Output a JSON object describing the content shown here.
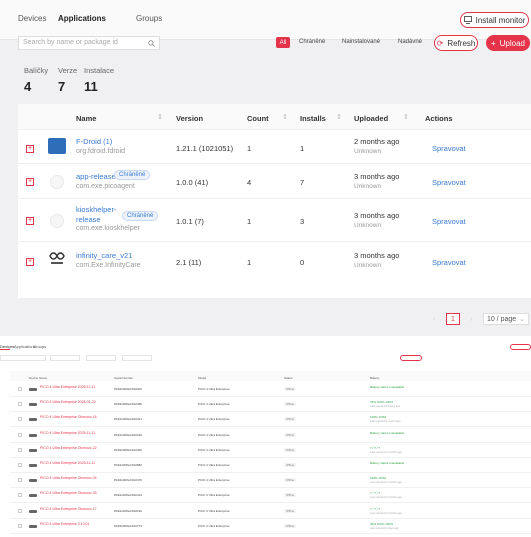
{
  "nav": {
    "tabs": [
      "Devices",
      "Applications",
      "Groups"
    ],
    "install_monitor": "Install monitor"
  },
  "toolbar": {
    "search_placeholder": "Search by name or package id",
    "filters": [
      "All",
      "Chráněné",
      "Nainstalované",
      "Nadávné"
    ],
    "refresh": "Refresh",
    "upload": "Upload"
  },
  "stats": [
    {
      "label": "Balíčky",
      "value": "4"
    },
    {
      "label": "Verze",
      "value": "7"
    },
    {
      "label": "Instalace",
      "value": "11"
    }
  ],
  "table": {
    "columns": [
      "Name",
      "Version",
      "Count",
      "Installs",
      "Uploaded",
      "Actions"
    ],
    "rows": [
      {
        "name": "F-Droid (1)",
        "id": "org.fdroid.fdroid",
        "badge": "",
        "version": "1.21.1 (1021051)",
        "count": "1",
        "installs": "1",
        "uploaded": "2 months ago",
        "uploader": "Unknown",
        "action": "Spravovat"
      },
      {
        "name": "app-release",
        "id": "com.exe.picoagent",
        "badge": "Chráněné",
        "version": "1.0.0 (41)",
        "count": "4",
        "installs": "7",
        "uploaded": "3 months ago",
        "uploader": "Unknown",
        "action": "Spravovat"
      },
      {
        "name": "kioskhelper-release",
        "name_line1": "kioskhelper-",
        "name_line2": "release",
        "id": "com.exe.kioskhelper",
        "badge": "Chráněné",
        "version": "1.0.1 (7)",
        "count": "1",
        "installs": "3",
        "uploaded": "3 months ago",
        "uploader": "Unknown",
        "action": "Spravovat"
      },
      {
        "name": "infinity_care_v21",
        "id": "com.Exe.InfinityCare",
        "badge": "",
        "version": "2.1 (11)",
        "count": "1",
        "installs": "0",
        "uploaded": "3 months ago",
        "uploader": "Unknown",
        "action": "Spravovat"
      }
    ]
  },
  "pagination": {
    "current": "1",
    "page_size": "10 / page"
  },
  "lower": {
    "tabs": [
      "Devices",
      "Applications",
      "Groups"
    ],
    "columns": [
      "Device Name",
      "Serial Number",
      "Model",
      "Status",
      "Battery"
    ],
    "rows": [
      {
        "name": "PICO 4 Ultra Enterprise 2025-11-11",
        "serial": "PA9410MGA3G0900",
        "model": "PICO 4 Ultra Enterprise",
        "status": "Offline",
        "battery": "Battery status unavailable",
        "bat_sub": ""
      },
      {
        "name": "PICO 4 Ultra Enterprise 2026-01-22",
        "serial": "PA9410MGA3G0485",
        "model": "PICO 4 Ultra Enterprise",
        "status": "Offline",
        "battery": "78%  100% 100%",
        "bat_sub": "Last reported 18 days ago"
      },
      {
        "name": "PICO 4 Ultra Enterprise Olomouc 16",
        "serial": "PA9410MGA3G0321",
        "model": "PICO 4 Ultra Enterprise",
        "status": "Offline",
        "battery": "100% 100%",
        "bat_sub": "Last reported 1 month ago"
      },
      {
        "name": "PICO 4 Ultra Enterprise 2025-11-11",
        "serial": "PA9410MGA3G0230",
        "model": "PICO 4 Ultra Enterprise",
        "status": "Offline",
        "battery": "Battery status unavailable",
        "bat_sub": ""
      },
      {
        "name": "PICO 4 Ultra Enterprise Olomouc 22",
        "serial": "PA9410MGA3G0446",
        "model": "PICO 4 Ultra Enterprise",
        "status": "Offline",
        "battery": "? / ? / ?",
        "bat_sub": "Last reported 2 months ago"
      },
      {
        "name": "PICO 4 Ultra Enterprise 2025-11-11",
        "serial": "PA9410MGA3G0882",
        "model": "PICO 4 Ultra Enterprise",
        "status": "Offline",
        "battery": "Battery status unavailable",
        "bat_sub": ""
      },
      {
        "name": "PICO 4 Ultra Enterprise Olomouc 04",
        "serial": "PA9410MGA3G0470",
        "model": "PICO 4 Ultra Enterprise",
        "status": "Offline",
        "battery": "100% 100%",
        "bat_sub": "Last reported 2 months ago"
      },
      {
        "name": "PICO 4 Ultra Enterprise Olomouc 03",
        "serial": "PA9410MGA3G0413",
        "model": "PICO 4 Ultra Enterprise",
        "status": "Offline",
        "battery": "? / ? / ?",
        "bat_sub": "Last reported 2 months ago"
      },
      {
        "name": "PICO 4 Ultra Enterprise Olomouc 17",
        "serial": "PA9410MGA3G0190",
        "model": "PICO 4 Ultra Enterprise",
        "status": "Offline",
        "battery": "? / ? / ?",
        "bat_sub": "Last reported 2 months ago"
      },
      {
        "name": "PICO 4 Ultra Enterprise 3.10.01",
        "serial": "PA9410MGA3G0773",
        "model": "PICO 4 Ultra Enterprise",
        "status": "Offline",
        "battery": "46%  100% 100%",
        "bat_sub": "Last reported 4 days ago"
      }
    ]
  }
}
